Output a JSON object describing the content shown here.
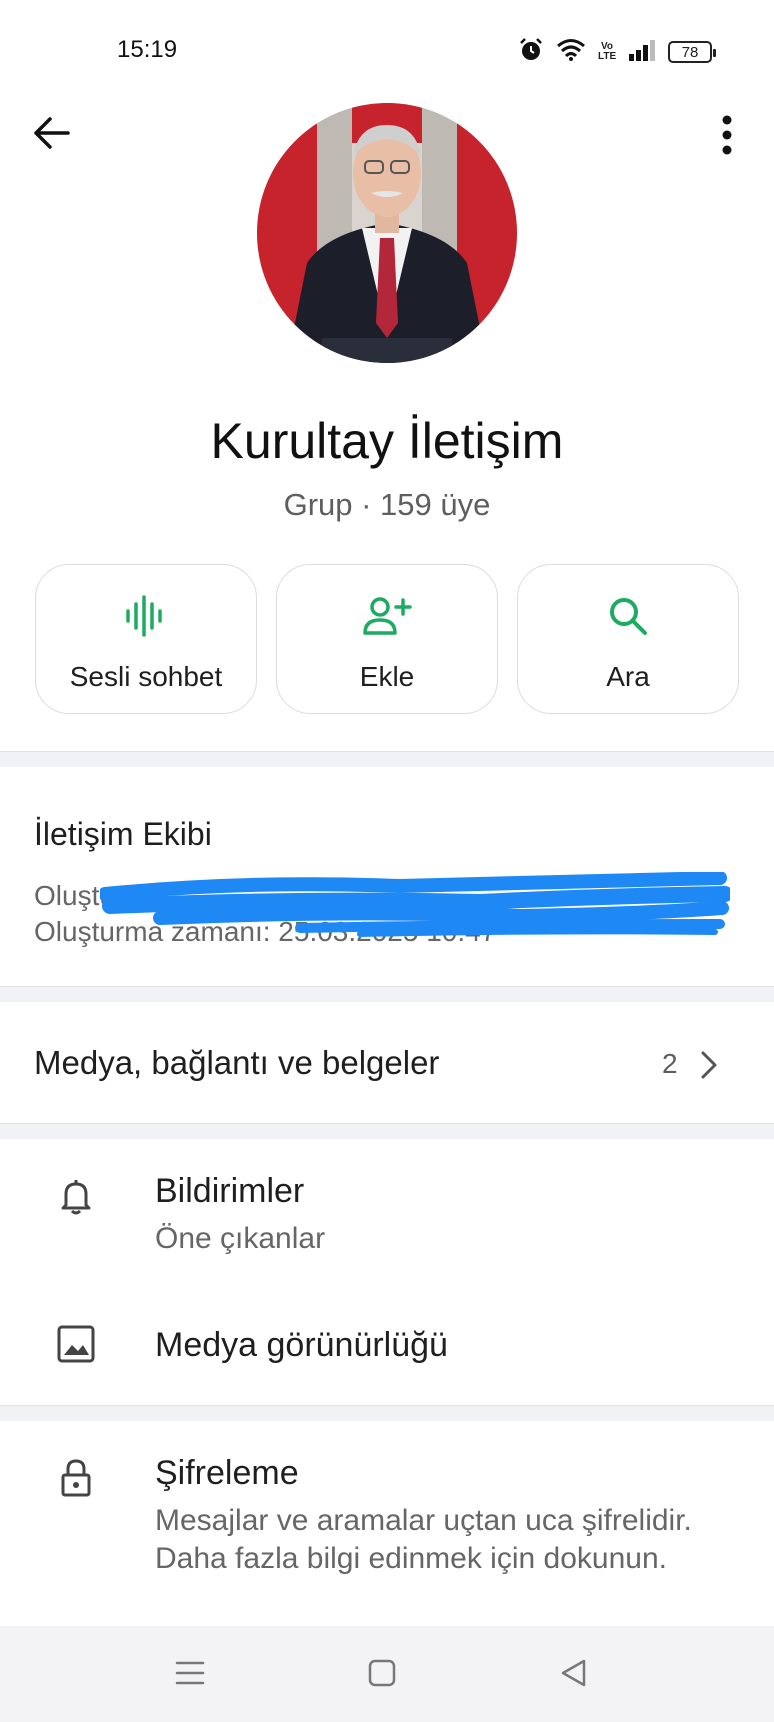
{
  "status_bar": {
    "time": "15:19",
    "icons": [
      "alarm-icon",
      "wifi-icon",
      "volte-icon",
      "signal-icon",
      "battery-icon"
    ],
    "volte_label": "Vo LTE",
    "battery": "78"
  },
  "header": {
    "back_icon": "arrow-left-icon",
    "menu_icon": "more-vert-icon"
  },
  "group": {
    "name": "Kurultay İletişim",
    "subtitle": "Grup · 159 üye"
  },
  "actions": [
    {
      "label": "Sesli sohbet",
      "icon": "voice-wave-icon"
    },
    {
      "label": "Ekle",
      "icon": "add-person-icon"
    },
    {
      "label": "Ara",
      "icon": "search-icon"
    }
  ],
  "description": {
    "title": "İletişim Ekibi",
    "creator_label": "Oluşturan:",
    "created_at": "Oluşturma zamanı: 25.03.2025 10:47"
  },
  "media": {
    "label": "Medya, bağlantı ve belgeler",
    "count": "2"
  },
  "settings": {
    "notifications": {
      "title": "Bildirimler",
      "subtitle": "Öne çıkanlar"
    },
    "media_visibility": {
      "title": "Medya görünürlüğü"
    },
    "encryption": {
      "title": "Şifreleme",
      "subtitle": "Mesajlar ve aramalar uçtan uca şifrelidir. Daha fazla bilgi edinmek için dokunun."
    }
  },
  "colors": {
    "accent": "#1daa61",
    "redaction": "#1e88f5",
    "divider": "#f0f2f5"
  }
}
